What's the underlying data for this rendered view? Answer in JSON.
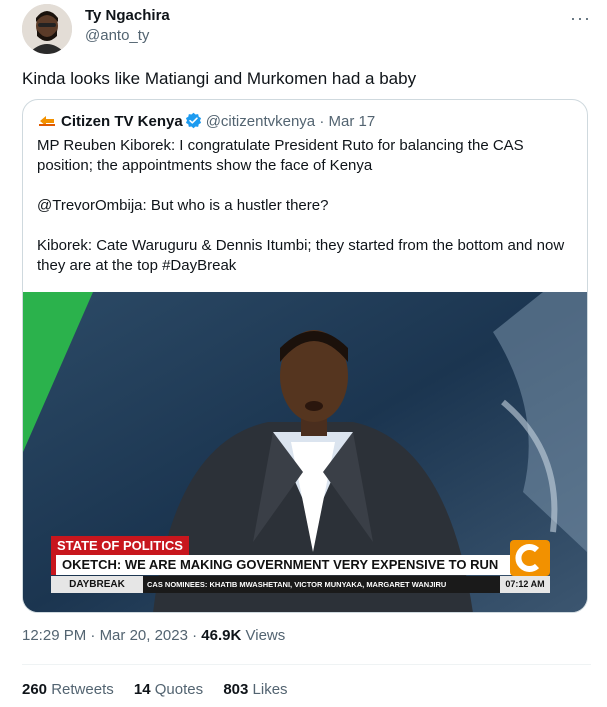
{
  "author": {
    "display_name": "Ty Ngachira",
    "handle": "@anto_ty",
    "more_label": "···"
  },
  "tweet": {
    "text": "Kinda looks like Matiangi and Murkomen had a baby"
  },
  "quoted": {
    "display_name": "Citizen TV Kenya",
    "handle": "@citizentvkenya",
    "separator": "·",
    "date": "Mar 17",
    "paragraphs": [
      "MP Reuben Kiborek: I congratulate President Ruto for balancing the CAS position; the appointments show the face of Kenya",
      "@TrevorOmbija: But who is a hustler there?",
      "Kiborek: Cate Waruguru & Dennis Itumbi; they started from the bottom and now they are at the top #DayBreak"
    ],
    "media": {
      "segment_label": "STATE OF POLITICS",
      "headline": "OKETCH: WE ARE MAKING GOVERNMENT VERY EXPENSIVE TO RUN",
      "show_name": "DAYBREAK",
      "ticker": "CAS NOMINEES: KHATIB MWASHETANI, VICTOR MUNYAKA, MARGARET WANJIRU",
      "time": "07:12 AM"
    }
  },
  "meta": {
    "time": "12:29 PM",
    "separator": "·",
    "date": "Mar 20, 2023",
    "views_count": "46.9K",
    "views_label": "Views"
  },
  "stats": {
    "retweets_count": "260",
    "retweets_label": "Retweets",
    "quotes_count": "14",
    "quotes_label": "Quotes",
    "likes_count": "803",
    "likes_label": "Likes"
  },
  "colors": {
    "text_primary": "#0f1419",
    "text_secondary": "#536471",
    "verified_blue": "#1d9bf0",
    "border": "#cfd9de",
    "news_red": "#c8161d",
    "citizen_orange": "#f29100"
  },
  "icons": [
    "avatar-photo",
    "more-icon",
    "citizen-tv-logo",
    "verified-badge-icon",
    "citizen-tv-c-logo"
  ]
}
